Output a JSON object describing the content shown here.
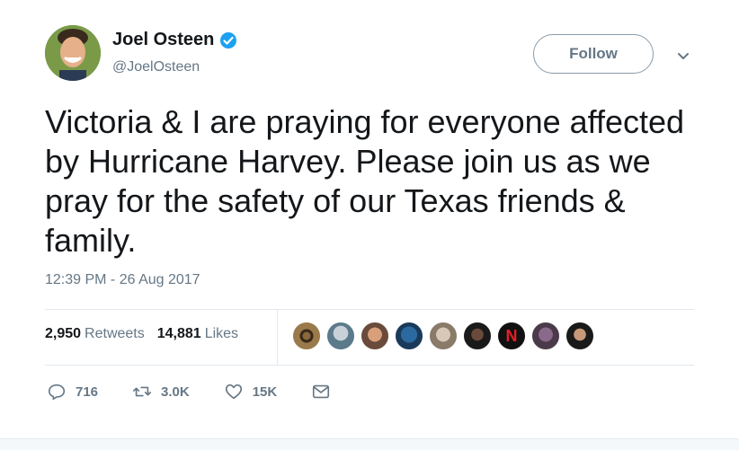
{
  "user": {
    "name": "Joel Osteen",
    "handle": "@JoelOsteen"
  },
  "follow_label": "Follow",
  "tweet": {
    "text": "Victoria & I are praying for everyone affected by Hurricane Harvey. Please join us as we pray for the safety of our Texas friends & family.",
    "timestamp": "12:39 PM - 26 Aug 2017"
  },
  "stats": {
    "retweets_count": "2,950",
    "retweets_label": "Retweets",
    "likes_count": "14,881",
    "likes_label": "Likes"
  },
  "liker_avatars": 9,
  "actions": {
    "reply_count": "716",
    "retweet_count": "3.0K",
    "like_count": "15K"
  },
  "colors": {
    "verified": "#1da1f2",
    "secondary_text": "#657786",
    "divider": "#e1e8ed"
  }
}
